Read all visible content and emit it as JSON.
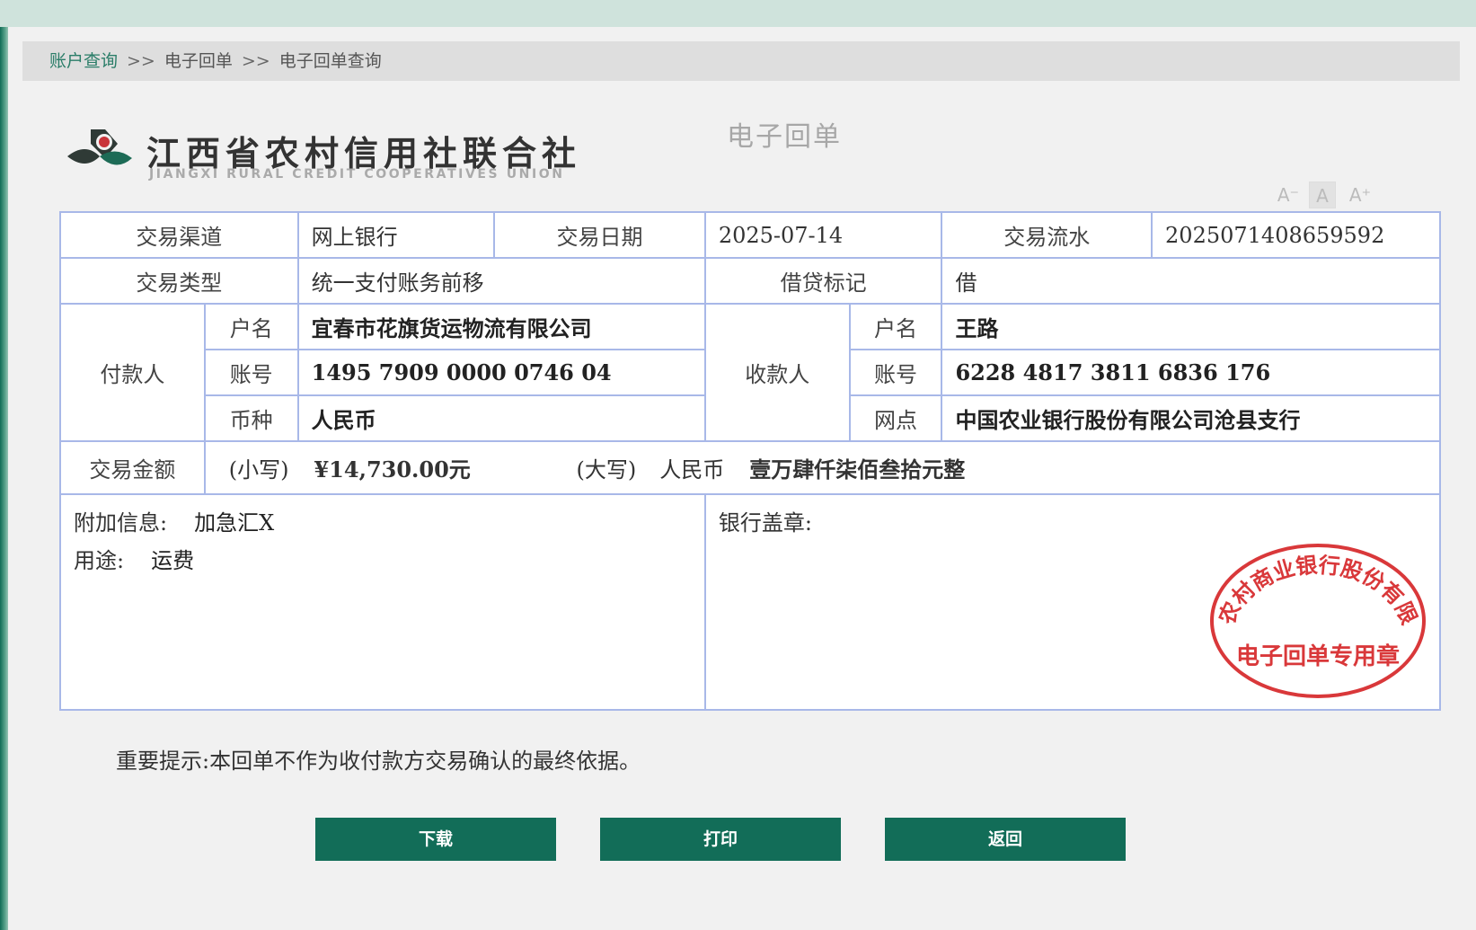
{
  "breadcrumb": {
    "items": [
      "账户查询",
      "电子回单",
      "电子回单查询"
    ],
    "separator": ">>"
  },
  "logo": {
    "name_cn": "江西省农村信用社联合社",
    "name_en": "JIANGXI RURAL CREDIT COOPERATIVES UNION"
  },
  "document_title": "电子回单",
  "font_controls": {
    "decrease": "A⁻",
    "normal": "A",
    "increase": "A⁺"
  },
  "receipt": {
    "channel_label": "交易渠道",
    "channel": "网上银行",
    "date_label": "交易日期",
    "date": "2025-07-14",
    "serial_label": "交易流水",
    "serial": "2025071408659592",
    "type_label": "交易类型",
    "type": "统一支付账务前移",
    "dc_label": "借贷标记",
    "dc": "借",
    "payer": {
      "label": "付款人",
      "name_label": "户名",
      "name": "宜春市花旗货运物流有限公司",
      "account_label": "账号",
      "account": "1495 7909 0000 0746 04",
      "currency_label": "币种",
      "currency": "人民币"
    },
    "payee": {
      "label": "收款人",
      "name_label": "户名",
      "name": "王路",
      "account_label": "账号",
      "account": "6228 4817 3811 6836 176",
      "branch_label": "网点",
      "branch": "中国农业银行股份有限公司沧县支行"
    },
    "amount_label": "交易金额",
    "amount_small_label": "(小写)",
    "amount_small": "¥14,730.00元",
    "amount_big_label": "(大写)",
    "amount_big_prefix": "人民币",
    "amount_big": "壹万肆仟柒佰叁拾元整",
    "extra_label": "附加信息:",
    "extra": "加急汇X",
    "purpose_label": "用途:",
    "purpose": "运费",
    "stamp_label": "银行盖章:",
    "stamp": {
      "ring_text": "宜春农村商业银行股份有限公司",
      "center_text": "电子回单专用章",
      "color": "#d9383a"
    }
  },
  "tip": "重要提示:本回单不作为收付款方交易确认的最终依据。",
  "buttons": {
    "download": "下载",
    "print": "打印",
    "back": "返回"
  },
  "colors": {
    "accent": "#126d58",
    "border": "#a8b8e8"
  }
}
